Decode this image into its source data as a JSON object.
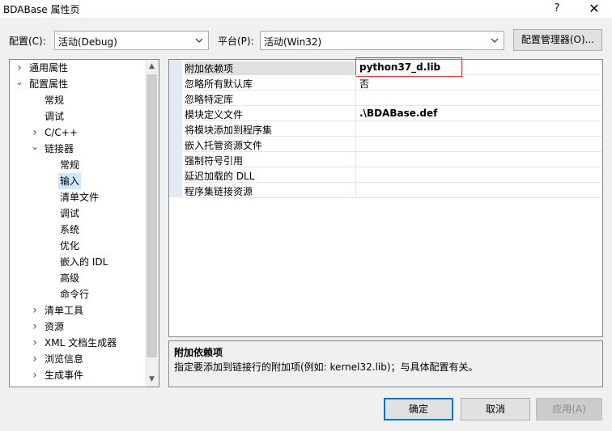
{
  "window": {
    "title": "BDABase 属性页",
    "help": "?",
    "close": "✕"
  },
  "config": {
    "label": "配置(C):",
    "value": "活动(Debug)"
  },
  "platform": {
    "label": "平台(P):",
    "value": "活动(Win32)"
  },
  "config_manager": "配置管理器(O)...",
  "tree": {
    "items": [
      {
        "label": "通用属性",
        "expander": "›"
      },
      {
        "label": "配置属性",
        "expander": "⌄"
      },
      {
        "label": "常规"
      },
      {
        "label": "调试"
      },
      {
        "label": "C/C++",
        "expander": "›"
      },
      {
        "label": "链接器",
        "expander": "⌄"
      },
      {
        "label": "常规"
      },
      {
        "label": "输入"
      },
      {
        "label": "清单文件"
      },
      {
        "label": "调试"
      },
      {
        "label": "系统"
      },
      {
        "label": "优化"
      },
      {
        "label": "嵌入的 IDL"
      },
      {
        "label": "高级"
      },
      {
        "label": "命令行"
      },
      {
        "label": "清单工具",
        "expander": "›"
      },
      {
        "label": "资源",
        "expander": "›"
      },
      {
        "label": "XML 文档生成器",
        "expander": "›"
      },
      {
        "label": "浏览信息",
        "expander": "›"
      },
      {
        "label": "生成事件",
        "expander": "›"
      }
    ]
  },
  "grid": {
    "rows": [
      {
        "name": "附加依赖项",
        "value": "python37_d.lib"
      },
      {
        "name": "忽略所有默认库",
        "value": "否"
      },
      {
        "name": "忽略特定库",
        "value": ""
      },
      {
        "name": "模块定义文件",
        "value": ".\\BDABase.def"
      },
      {
        "name": "将模块添加到程序集",
        "value": ""
      },
      {
        "name": "嵌入托管资源文件",
        "value": ""
      },
      {
        "name": "强制符号引用",
        "value": ""
      },
      {
        "name": "延迟加载的 DLL",
        "value": ""
      },
      {
        "name": "程序集链接资源",
        "value": ""
      }
    ]
  },
  "description": {
    "title": "附加依赖项",
    "text": "指定要添加到链接行的附加项(例如: kernel32.lib)；与具体配置有关。"
  },
  "buttons": {
    "ok": "确定",
    "cancel": "取消",
    "apply": "应用(A)"
  },
  "colors": {
    "selection": "#cce8ff",
    "highlight_border": "#e0332c",
    "default_button_border": "#0078d7"
  }
}
